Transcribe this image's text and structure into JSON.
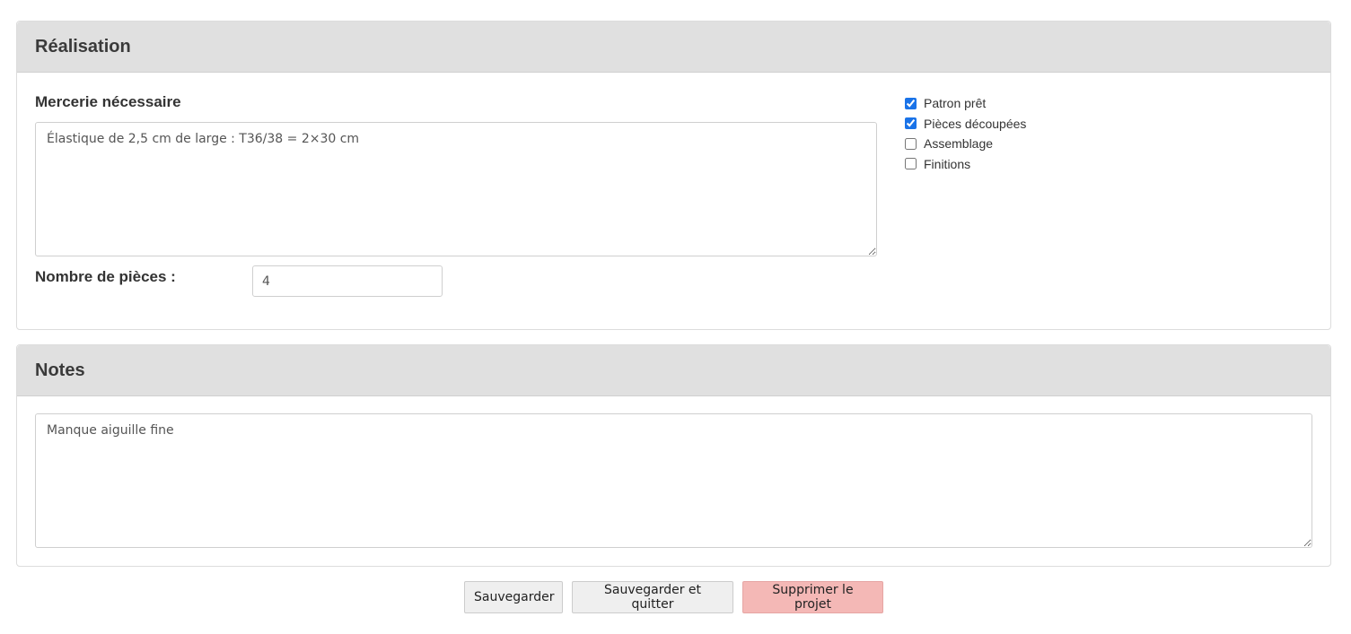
{
  "realisation": {
    "title": "Réalisation",
    "mercerie_label": "Mercerie nécessaire",
    "mercerie_value": "Élastique de 2,5 cm de large : T36/38 = 2×30 cm",
    "pieces_label": "Nombre de pièces :",
    "pieces_value": "4",
    "checklist": [
      {
        "label": "Patron prêt",
        "checked": true
      },
      {
        "label": "Pièces découpées",
        "checked": true
      },
      {
        "label": "Assemblage",
        "checked": false
      },
      {
        "label": "Finitions",
        "checked": false
      }
    ]
  },
  "notes": {
    "title": "Notes",
    "value": "Manque aiguille fine"
  },
  "actions": {
    "save": "Sauvegarder",
    "save_quit": "Sauvegarder et quitter",
    "delete": "Supprimer le projet",
    "delete_color": "#f4b8b6"
  }
}
